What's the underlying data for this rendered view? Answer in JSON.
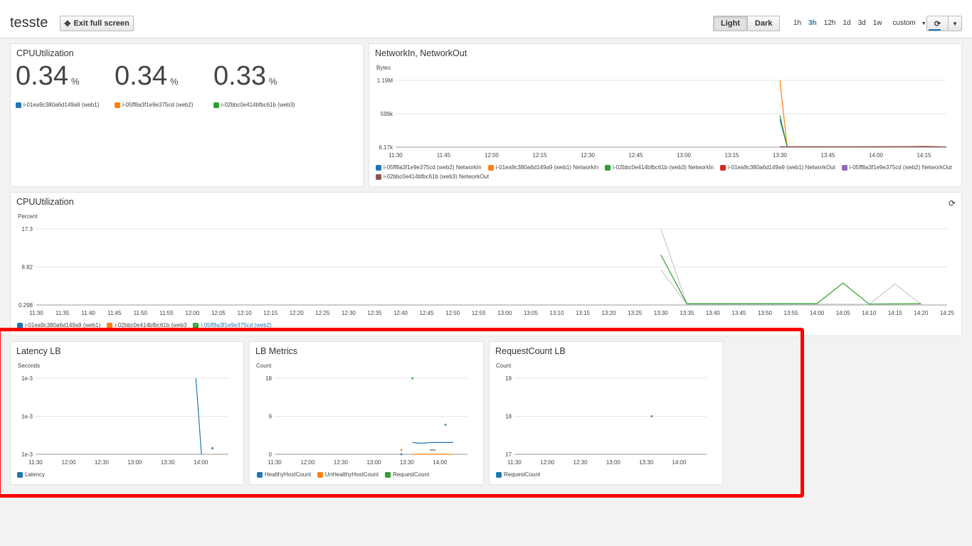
{
  "header": {
    "title": "tesste",
    "exit_fullscreen_label": "Exit full screen",
    "theme_light": "Light",
    "theme_dark": "Dark",
    "ranges": [
      "1h",
      "3h",
      "12h",
      "1d",
      "3d",
      "1w"
    ],
    "selected_range": "3h",
    "custom_label": "custom"
  },
  "colors": {
    "blue": "#1f77b4",
    "orange": "#ff7f0e",
    "green": "#2ca02c",
    "red": "#d62728",
    "purple": "#9467bd",
    "brown": "#8c564b",
    "highlight": "#ff0000"
  },
  "icons": {
    "exit_fullscreen": "expand-arrows-icon",
    "refresh": "refresh-icon",
    "dropdown": "caret-down-icon"
  },
  "cpu_single": {
    "title": "CPUUtilization",
    "values": [
      {
        "value": "0.34",
        "unit": "%",
        "label": "i-01ea9c380a6d149a9 (web1)",
        "color": "#1f77b4"
      },
      {
        "value": "0.34",
        "unit": "%",
        "label": "i-05ff8a3f1e9e375cd (web2)",
        "color": "#ff7f0e"
      },
      {
        "value": "0.33",
        "unit": "%",
        "label": "i-02bbc0e414bfbc61b (web3)",
        "color": "#2ca02c"
      }
    ]
  },
  "network": {
    "title": "NetworkIn, NetworkOut",
    "ylabel": "Bytes",
    "legend": [
      {
        "label": "i-05ff8a3f1e9e375cd (web2) NetworkIn",
        "color": "#1f77b4"
      },
      {
        "label": "i-01ea9c380a6d149a9 (web1) NetworkIn",
        "color": "#ff7f0e"
      },
      {
        "label": "i-02bbc0e414bfbc61b (web3) NetworkIn",
        "color": "#2ca02c"
      },
      {
        "label": "i-01ea9c380a6d149a9 (web1) NetworkOut",
        "color": "#d62728"
      },
      {
        "label": "i-05ff8a3f1e9e375cd (web2) NetworkOut",
        "color": "#9467bd"
      },
      {
        "label": "i-02bbc0e414bfbc61b (web3) NetworkOut",
        "color": "#8c564b"
      }
    ]
  },
  "cpu_graph": {
    "title": "CPUUtilization",
    "ylabel": "Percent",
    "legend": [
      {
        "label": "i-01ea9c380a6d149a9 (web1)",
        "color": "#1f77b4"
      },
      {
        "label": "i-02bbc0e414bfbc61b (web3",
        "color": "#ff7f0e"
      },
      {
        "label": "i-05ff8a3f1e9e375cd (web2)",
        "color": "#2ca02c"
      }
    ]
  },
  "latency": {
    "title": "Latency LB",
    "ylabel": "Seconds",
    "legend": [
      {
        "label": "Latency",
        "color": "#1f77b4"
      }
    ]
  },
  "lbmetrics": {
    "title": "LB Metrics",
    "ylabel": "Count",
    "legend": [
      {
        "label": "HealthyHostCount",
        "color": "#1f77b4"
      },
      {
        "label": "UnHealthyHostCount",
        "color": "#ff7f0e"
      },
      {
        "label": "RequestCount",
        "color": "#2ca02c"
      }
    ]
  },
  "requestcount": {
    "title": "RequestCount LB",
    "ylabel": "Count",
    "legend": [
      {
        "label": "RequestCount",
        "color": "#1f77b4"
      }
    ]
  },
  "chart_data": [
    {
      "type": "line",
      "id": "network",
      "title": "NetworkIn, NetworkOut",
      "ylabel": "Bytes",
      "y_ticks": [
        "6.17k",
        "599k",
        "1.19M"
      ],
      "y_tick_values": [
        6170,
        599000,
        1190000
      ],
      "ylim": [
        6170,
        1190000
      ],
      "x_ticks": [
        "11:30",
        "11:45",
        "12:00",
        "12:15",
        "12:30",
        "12:45",
        "13:00",
        "13:15",
        "13:30",
        "13:45",
        "14:00",
        "14:15"
      ],
      "x_tick_minutes": [
        690,
        705,
        720,
        735,
        750,
        765,
        780,
        795,
        810,
        825,
        840,
        855
      ],
      "xlim": [
        690,
        862
      ],
      "series": [
        {
          "name": "i-05ff8a3f1e9e375cd (web2) NetworkIn",
          "color": "#1f77b4",
          "x": [
            810,
            812.3,
            862
          ],
          "y": [
            500000,
            10000,
            8000
          ]
        },
        {
          "name": "i-01ea9c380a6d149a9 (web1) NetworkIn",
          "color": "#ff7f0e",
          "x": [
            810,
            812.3,
            862
          ],
          "y": [
            1190000,
            10000,
            8000
          ]
        },
        {
          "name": "i-02bbc0e414bfbc61b (web3) NetworkIn",
          "color": "#2ca02c",
          "x": [
            810,
            812.3,
            862
          ],
          "y": [
            570000,
            10000,
            9000
          ]
        },
        {
          "name": "i-01ea9c380a6d149a9 (web1) NetworkOut",
          "color": "#d62728",
          "x": [
            810,
            835,
            850,
            855,
            862
          ],
          "y": [
            15000,
            12000,
            14000,
            20000,
            10000
          ]
        },
        {
          "name": "i-05ff8a3f1e9e375cd (web2) NetworkOut",
          "color": "#9467bd",
          "x": [
            810,
            830,
            845,
            862
          ],
          "y": [
            12000,
            11000,
            13000,
            9000
          ]
        },
        {
          "name": "i-02bbc0e414bfbc61b (web3) NetworkOut",
          "color": "#8c564b",
          "x": [
            810,
            835,
            855,
            862
          ],
          "y": [
            11000,
            13000,
            16000,
            9000
          ]
        }
      ]
    },
    {
      "type": "line",
      "id": "cpu",
      "title": "CPUUtilization",
      "ylabel": "Percent",
      "y_ticks": [
        "0.298",
        "8.82",
        "17.3"
      ],
      "y_tick_values": [
        0.298,
        8.82,
        17.3
      ],
      "ylim": [
        0.298,
        17.3
      ],
      "x_ticks": [
        "11:30",
        "11:35",
        "11:40",
        "11:45",
        "11:50",
        "11:55",
        "12:00",
        "12:05",
        "12:10",
        "12:15",
        "12:20",
        "12:25",
        "12:30",
        "12:35",
        "12:40",
        "12:45",
        "12:50",
        "12:55",
        "13:00",
        "13:05",
        "13:10",
        "13:15",
        "13:20",
        "13:25",
        "13:30",
        "13:35",
        "13:40",
        "13:45",
        "13:50",
        "13:55",
        "14:00",
        "14:05",
        "14:10",
        "14:15",
        "14:20",
        "14:25"
      ],
      "x_tick_minutes": [
        690,
        695,
        700,
        705,
        710,
        715,
        720,
        725,
        730,
        735,
        740,
        745,
        750,
        755,
        760,
        765,
        770,
        775,
        780,
        785,
        790,
        795,
        800,
        805,
        810,
        815,
        820,
        825,
        830,
        835,
        840,
        845,
        850,
        855,
        860,
        865
      ],
      "xlim": [
        690,
        865
      ],
      "series": [
        {
          "name": "i-01ea9c380a6d149a9 (web1)",
          "color": "#c9c9c9",
          "x": [
            810,
            815,
            840,
            850,
            855,
            860
          ],
          "y": [
            17.3,
            0.5,
            0.5,
            0.45,
            5.0,
            0.45
          ]
        },
        {
          "name": "i-02bbc0e414bfbc61b (web3",
          "color": "#c9c9c9",
          "x": [
            810,
            815,
            850,
            860
          ],
          "y": [
            8.2,
            0.45,
            0.4,
            0.4
          ]
        },
        {
          "name": "i-05ff8a3f1e9e375cd (web2)",
          "color": "#2ca02c",
          "x": [
            810,
            815,
            840,
            845,
            850,
            860
          ],
          "y": [
            11.5,
            0.6,
            0.6,
            5.2,
            0.5,
            0.6
          ]
        }
      ]
    },
    {
      "type": "line",
      "id": "latency",
      "title": "Latency LB",
      "ylabel": "Seconds",
      "y_ticks": [
        "1e-3",
        "1e-3",
        "1e-3"
      ],
      "ylim": [
        0,
        1
      ],
      "x_ticks": [
        "11:30",
        "12:00",
        "12:30",
        "13:00",
        "13:30",
        "14:00"
      ],
      "x_tick_minutes": [
        690,
        720,
        750,
        780,
        810,
        840
      ],
      "xlim": [
        690,
        865
      ],
      "series": [
        {
          "name": "Latency",
          "color": "#1f77b4",
          "x": [
            835.5,
            840.5
          ],
          "y": [
            1.0,
            0.0
          ],
          "points": [
            {
              "x": 850.5,
              "y": 0.08
            }
          ]
        }
      ]
    },
    {
      "type": "line",
      "id": "lbmetrics",
      "title": "LB Metrics",
      "ylabel": "Count",
      "y_ticks": [
        "0",
        "9",
        "18"
      ],
      "y_tick_values": [
        0,
        9,
        18
      ],
      "ylim": [
        0,
        18
      ],
      "x_ticks": [
        "11:30",
        "12:00",
        "12:30",
        "13:00",
        "13:30",
        "14:00"
      ],
      "x_tick_minutes": [
        690,
        720,
        750,
        780,
        810,
        840
      ],
      "xlim": [
        690,
        865
      ],
      "series": [
        {
          "name": "HealthyHostCount",
          "color": "#1f77b4",
          "x": [
            815,
            820,
            823,
            833,
            852
          ],
          "y": [
            2.8,
            2.7,
            2.6,
            2.8,
            2.8
          ],
          "points": [
            {
              "x": 805,
              "y": 0
            }
          ]
        },
        {
          "name": "UnHealthyHostCount",
          "color": "#ff7f0e",
          "x": [
            815,
            852
          ],
          "y": [
            0,
            0
          ],
          "points": [
            {
              "x": 805,
              "y": 1
            }
          ]
        },
        {
          "name": "RequestCount",
          "color": "#2ca02c",
          "x": [],
          "y": [],
          "points": [
            {
              "x": 815,
              "y": 18
            },
            {
              "x": 845,
              "y": 7
            }
          ]
        }
      ]
    },
    {
      "type": "line",
      "id": "requestcount",
      "title": "RequestCount LB",
      "ylabel": "Count",
      "y_ticks": [
        "17",
        "18",
        "19"
      ],
      "y_tick_values": [
        17,
        18,
        19
      ],
      "ylim": [
        17,
        19
      ],
      "x_ticks": [
        "11:30",
        "12:00",
        "12:30",
        "13:00",
        "13:30",
        "14:00"
      ],
      "x_tick_minutes": [
        690,
        720,
        750,
        780,
        810,
        840
      ],
      "xlim": [
        690,
        865
      ],
      "series": [
        {
          "name": "RequestCount",
          "color": "#2ca02c",
          "x": [],
          "y": [],
          "points": [
            {
              "x": 815,
              "y": 18
            }
          ]
        }
      ]
    }
  ]
}
